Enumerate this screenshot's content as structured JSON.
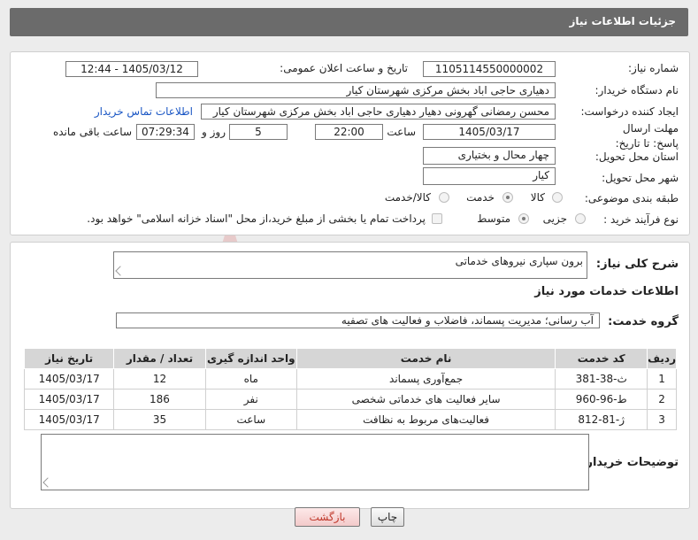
{
  "header": {
    "title": "جزئیات اطلاعات نیاز"
  },
  "form": {
    "need_number_label": "شماره نیاز:",
    "need_number": "1105114550000002",
    "announce_label": "تاریخ و ساعت اعلان عمومی:",
    "announce_value": "1405/03/12 - 12:44",
    "buyer_org_label": "نام دستگاه خریدار:",
    "buyer_org": "دهیاری حاجی اباد بخش مرکزی شهرستان کیار",
    "creator_label": "ایجاد کننده درخواست:",
    "creator": "محسن رمضانی گهرونی دهیار دهیاری حاجی اباد بخش مرکزی شهرستان کیار",
    "contact_link": "اطلاعات تماس خریدار",
    "deadline_label": "مهلت ارسال پاسخ: تا تاریخ:",
    "deadline_date": "1405/03/17",
    "time_label": "ساعت",
    "deadline_time": "22:00",
    "days_value": "5",
    "days_label": "روز و",
    "remaining_time": "07:29:34",
    "remaining_label": "ساعت باقی مانده",
    "province_label": "استان محل تحویل:",
    "province": "چهار محال و بختیاری",
    "city_label": "شهر محل تحویل:",
    "city": "کیار",
    "category_label": "طبقه بندی موضوعی:",
    "category_options": [
      "کالا",
      "خدمت",
      "کالا/خدمت"
    ],
    "category_selected": "خدمت",
    "process_label": "نوع فرآیند خرید :",
    "process_options": [
      "جزیی",
      "متوسط"
    ],
    "process_selected": "متوسط",
    "payment_note": "پرداخت تمام یا بخشی از مبلغ خرید،از محل \"اسناد خزانه اسلامی\" خواهد بود."
  },
  "summary": {
    "label": "شرح کلی نیاز:",
    "value": "برون سپاری نیروهای خدماتی"
  },
  "services": {
    "section_title": "اطلاعات خدمات مورد نیاز",
    "group_label": "گروه خدمت:",
    "group_value": "آب رسانی؛ مدیریت پسماند، فاضلاب و فعالیت های تصفیه",
    "columns": [
      "ردیف",
      "کد خدمت",
      "نام خدمت",
      "واحد اندازه گیری",
      "تعداد / مقدار",
      "تاریخ نیاز"
    ],
    "rows": [
      [
        "1",
        "ث-38-381",
        "جمع‌آوری پسماند",
        "ماه",
        "12",
        "1405/03/17"
      ],
      [
        "2",
        "ط-96-960",
        "سایر فعالیت های خدماتی شخصی",
        "نفر",
        "186",
        "1405/03/17"
      ],
      [
        "3",
        "ژ-81-812",
        "فعالیت‌های مربوط به نظافت",
        "ساعت",
        "35",
        "1405/03/17"
      ]
    ]
  },
  "buyer_notes": {
    "label": "توضیحات خریدار:",
    "value": ""
  },
  "buttons": {
    "print": "چاپ",
    "back": "بازگشت"
  },
  "watermark": {
    "text": "AriaTender.net"
  },
  "colors": {
    "header": "#6b6b6b",
    "link": "#1a56c4",
    "back_text": "#c0392b",
    "watermark": "#e3a3a3"
  }
}
